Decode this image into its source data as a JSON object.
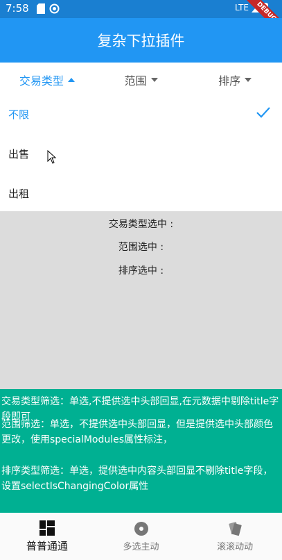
{
  "status": {
    "time": "7:58",
    "network": "LTE",
    "debug": "DEBUG"
  },
  "appbar": {
    "title": "复杂下拉插件"
  },
  "filters": [
    {
      "label": "交易类型",
      "active": true
    },
    {
      "label": "范围",
      "active": false
    },
    {
      "label": "排序",
      "active": false
    }
  ],
  "options": [
    {
      "label": "不限",
      "selected": true
    },
    {
      "label": "出售",
      "selected": false
    },
    {
      "label": "出租",
      "selected": false
    }
  ],
  "results": {
    "type": "交易类型选中 :",
    "range": "范围选中 :",
    "sort": "排序选中 :"
  },
  "info": {
    "p1": "交易类型筛选：单选,不提供选中头部回显,在元数据中剔除title字段即可",
    "p2": "范围筛选：单选，不提供选中头部回显，但是提供选中头部颜色更改，使用specialModules属性标注，",
    "p3": "排序类型筛选：单选，提供选中内容头部回显不剔除title字段，设置selectIsChangingColor属性"
  },
  "nav": [
    {
      "label": "普普通通",
      "icon": "dashboard-icon",
      "active": true
    },
    {
      "label": "多选主动",
      "icon": "disc-icon",
      "active": false
    },
    {
      "label": "滚滚动动",
      "icon": "cards-icon",
      "active": false
    }
  ],
  "colors": {
    "primary": "#2196f3",
    "statusbar": "#1a7fd1",
    "info_bg": "#00b092",
    "overlay": "#dcdcdc"
  }
}
